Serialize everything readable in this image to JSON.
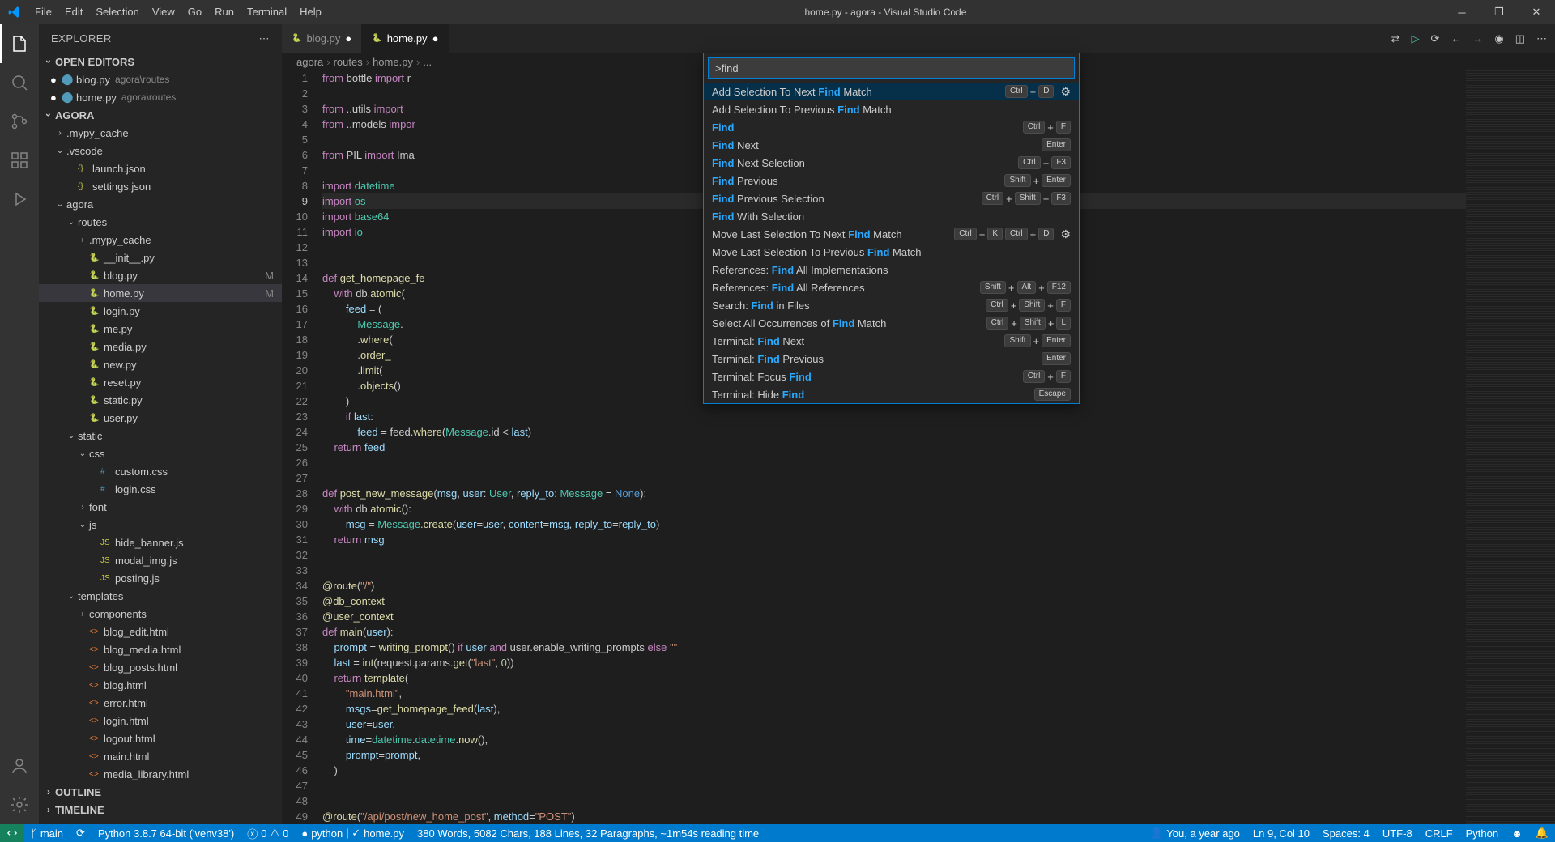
{
  "title": "home.py - agora - Visual Studio Code",
  "menu": [
    "File",
    "Edit",
    "Selection",
    "View",
    "Go",
    "Run",
    "Terminal",
    "Help"
  ],
  "sidebar": {
    "title": "EXPLORER",
    "open_editors": "OPEN EDITORS",
    "project": "AGORA",
    "outline": "OUTLINE",
    "timeline": "TIMELINE",
    "editors": [
      {
        "name": "blog.py",
        "desc": "agora\\routes",
        "mod": true
      },
      {
        "name": "home.py",
        "desc": "agora\\routes",
        "mod": true
      }
    ],
    "tree": [
      {
        "type": "folder",
        "name": ".mypy_cache",
        "indent": 1,
        "exp": false
      },
      {
        "type": "folder",
        "name": ".vscode",
        "indent": 1,
        "exp": true
      },
      {
        "type": "file",
        "name": "launch.json",
        "indent": 2,
        "ico": "json"
      },
      {
        "type": "file",
        "name": "settings.json",
        "indent": 2,
        "ico": "json"
      },
      {
        "type": "folder",
        "name": "agora",
        "indent": 1,
        "exp": true
      },
      {
        "type": "folder",
        "name": "routes",
        "indent": 2,
        "exp": true
      },
      {
        "type": "folder",
        "name": ".mypy_cache",
        "indent": 3,
        "exp": false
      },
      {
        "type": "file",
        "name": "__init__.py",
        "indent": 3,
        "ico": "py"
      },
      {
        "type": "file",
        "name": "blog.py",
        "indent": 3,
        "ico": "py",
        "mod": true
      },
      {
        "type": "file",
        "name": "home.py",
        "indent": 3,
        "ico": "py",
        "mod": true,
        "sel": true
      },
      {
        "type": "file",
        "name": "login.py",
        "indent": 3,
        "ico": "py"
      },
      {
        "type": "file",
        "name": "me.py",
        "indent": 3,
        "ico": "py"
      },
      {
        "type": "file",
        "name": "media.py",
        "indent": 3,
        "ico": "py"
      },
      {
        "type": "file",
        "name": "new.py",
        "indent": 3,
        "ico": "py"
      },
      {
        "type": "file",
        "name": "reset.py",
        "indent": 3,
        "ico": "py"
      },
      {
        "type": "file",
        "name": "static.py",
        "indent": 3,
        "ico": "py"
      },
      {
        "type": "file",
        "name": "user.py",
        "indent": 3,
        "ico": "py"
      },
      {
        "type": "folder",
        "name": "static",
        "indent": 2,
        "exp": true
      },
      {
        "type": "folder",
        "name": "css",
        "indent": 3,
        "exp": true
      },
      {
        "type": "file",
        "name": "custom.css",
        "indent": 4,
        "ico": "css"
      },
      {
        "type": "file",
        "name": "login.css",
        "indent": 4,
        "ico": "css"
      },
      {
        "type": "folder",
        "name": "font",
        "indent": 3,
        "exp": false
      },
      {
        "type": "folder",
        "name": "js",
        "indent": 3,
        "exp": true
      },
      {
        "type": "file",
        "name": "hide_banner.js",
        "indent": 4,
        "ico": "js"
      },
      {
        "type": "file",
        "name": "modal_img.js",
        "indent": 4,
        "ico": "js"
      },
      {
        "type": "file",
        "name": "posting.js",
        "indent": 4,
        "ico": "js"
      },
      {
        "type": "folder",
        "name": "templates",
        "indent": 2,
        "exp": true
      },
      {
        "type": "folder",
        "name": "components",
        "indent": 3,
        "exp": false
      },
      {
        "type": "file",
        "name": "blog_edit.html",
        "indent": 3,
        "ico": "html"
      },
      {
        "type": "file",
        "name": "blog_media.html",
        "indent": 3,
        "ico": "html"
      },
      {
        "type": "file",
        "name": "blog_posts.html",
        "indent": 3,
        "ico": "html"
      },
      {
        "type": "file",
        "name": "blog.html",
        "indent": 3,
        "ico": "html"
      },
      {
        "type": "file",
        "name": "error.html",
        "indent": 3,
        "ico": "html"
      },
      {
        "type": "file",
        "name": "login.html",
        "indent": 3,
        "ico": "html"
      },
      {
        "type": "file",
        "name": "logout.html",
        "indent": 3,
        "ico": "html"
      },
      {
        "type": "file",
        "name": "main.html",
        "indent": 3,
        "ico": "html"
      },
      {
        "type": "file",
        "name": "media_library.html",
        "indent": 3,
        "ico": "html"
      }
    ]
  },
  "tabs": [
    {
      "name": "blog.py",
      "mod": true,
      "active": false
    },
    {
      "name": "home.py",
      "mod": true,
      "active": true
    }
  ],
  "breadcrumb": [
    "agora",
    "routes",
    "home.py",
    "..."
  ],
  "palette": {
    "input": ">find",
    "items": [
      {
        "pre": "Add Selection To Next ",
        "hl": "Find",
        "post": " Match",
        "keys": [
          "Ctrl",
          "+",
          "D"
        ],
        "gear": true,
        "sel": true
      },
      {
        "pre": "Add Selection To Previous ",
        "hl": "Find",
        "post": " Match"
      },
      {
        "pre": "",
        "hl": "Find",
        "post": "",
        "keys": [
          "Ctrl",
          "+",
          "F"
        ]
      },
      {
        "pre": "",
        "hl": "Find",
        "post": " Next",
        "keys": [
          "Enter"
        ]
      },
      {
        "pre": "",
        "hl": "Find",
        "post": " Next Selection",
        "keys": [
          "Ctrl",
          "+",
          "F3"
        ]
      },
      {
        "pre": "",
        "hl": "Find",
        "post": " Previous",
        "keys": [
          "Shift",
          "+",
          "Enter"
        ]
      },
      {
        "pre": "",
        "hl": "Find",
        "post": " Previous Selection",
        "keys": [
          "Ctrl",
          "+",
          "Shift",
          "+",
          "F3"
        ]
      },
      {
        "pre": "",
        "hl": "Find",
        "post": " With Selection"
      },
      {
        "pre": "Move Last Selection To Next ",
        "hl": "Find",
        "post": " Match",
        "keys": [
          "Ctrl",
          "+",
          "K",
          "Ctrl",
          "+",
          "D"
        ],
        "gear": true
      },
      {
        "pre": "Move Last Selection To Previous ",
        "hl": "Find",
        "post": " Match"
      },
      {
        "pre": "References: ",
        "hl": "Find",
        "post": " All Implementations"
      },
      {
        "pre": "References: ",
        "hl": "Find",
        "post": " All References",
        "keys": [
          "Shift",
          "+",
          "Alt",
          "+",
          "F12"
        ]
      },
      {
        "pre": "Search: ",
        "hl": "Find",
        "post": " in Files",
        "keys": [
          "Ctrl",
          "+",
          "Shift",
          "+",
          "F"
        ]
      },
      {
        "pre": "Select All Occurrences of ",
        "hl": "Find",
        "post": " Match",
        "keys": [
          "Ctrl",
          "+",
          "Shift",
          "+",
          "L"
        ]
      },
      {
        "pre": "Terminal: ",
        "hl": "Find",
        "post": " Next",
        "keys": [
          "Shift",
          "+",
          "Enter"
        ]
      },
      {
        "pre": "Terminal: ",
        "hl": "Find",
        "post": " Previous",
        "keys": [
          "Enter"
        ]
      },
      {
        "pre": "Terminal: Focus ",
        "hl": "Find",
        "post": "",
        "keys": [
          "Ctrl",
          "+",
          "F"
        ]
      },
      {
        "pre": "Terminal: Hide ",
        "hl": "Find",
        "post": "",
        "keys": [
          "Escape"
        ]
      }
    ]
  },
  "code_lines": [
    "<span class='tok-kw'>from</span> bottle <span class='tok-kw'>import</span> r",
    "",
    "<span class='tok-kw'>from</span> ..utils <span class='tok-kw'>import</span>",
    "<span class='tok-kw'>from</span> ..models <span class='tok-kw'>impor</span>",
    "",
    "<span class='tok-kw'>from</span> PIL <span class='tok-kw'>import</span> Ima",
    "",
    "<span class='tok-kw'>import</span> <span class='tok-mod'>datetime</span>",
    "<span class='tok-kw'>import</span> <span class='tok-mod'>os</span>",
    "<span class='tok-kw'>import</span> <span class='tok-mod'>base64</span>",
    "<span class='tok-kw'>import</span> <span class='tok-mod'>io</span>",
    "",
    "",
    "<span class='tok-kw'>def</span> <span class='tok-fn'>get_homepage_fe</span>",
    "    <span class='tok-kw'>with</span> db.<span class='tok-fn'>atomic</span>(",
    "        <span class='tok-var'>feed</span> = (",
    "            <span class='tok-cls'>Message</span>.",
    "            .<span class='tok-fn'>where</span>(",
    "            .<span class='tok-fn'>order_</span>",
    "            .<span class='tok-fn'>limit</span>(",
    "            .<span class='tok-fn'>objects</span>()",
    "        )",
    "        <span class='tok-kw'>if</span> <span class='tok-var'>last</span>:",
    "            <span class='tok-var'>feed</span> = feed.<span class='tok-fn'>where</span>(<span class='tok-cls'>Message</span>.id &lt; <span class='tok-var'>last</span>)",
    "    <span class='tok-kw'>return</span> <span class='tok-var'>feed</span>",
    "",
    "",
    "<span class='tok-kw'>def</span> <span class='tok-fn'>post_new_message</span>(<span class='tok-var'>msg</span>, <span class='tok-var'>user</span>: <span class='tok-cls'>User</span>, <span class='tok-var'>reply_to</span>: <span class='tok-cls'>Message</span> = <span class='tok-const'>None</span>):",
    "    <span class='tok-kw'>with</span> db.<span class='tok-fn'>atomic</span>():",
    "        <span class='tok-var'>msg</span> = <span class='tok-cls'>Message</span>.<span class='tok-fn'>create</span>(<span class='tok-var'>user</span>=<span class='tok-var'>user</span>, <span class='tok-var'>content</span>=<span class='tok-var'>msg</span>, <span class='tok-var'>reply_to</span>=<span class='tok-var'>reply_to</span>)",
    "    <span class='tok-kw'>return</span> <span class='tok-var'>msg</span>",
    "",
    "",
    "<span class='tok-fn'>@route</span>(<span class='tok-str'>\"/\"</span>)",
    "<span class='tok-fn'>@db_context</span>",
    "<span class='tok-fn'>@user_context</span>",
    "<span class='tok-kw'>def</span> <span class='tok-fn'>main</span>(<span class='tok-var'>user</span>):",
    "    <span class='tok-var'>prompt</span> = <span class='tok-fn'>writing_prompt</span>() <span class='tok-kw'>if</span> <span class='tok-var'>user</span> <span class='tok-kw'>and</span> user.enable_writing_prompts <span class='tok-kw'>else</span> <span class='tok-str'>\"\"</span>",
    "    <span class='tok-var'>last</span> = <span class='tok-fn'>int</span>(request.params.<span class='tok-fn'>get</span>(<span class='tok-str'>\"last\"</span>, <span class='tok-num'>0</span>))",
    "    <span class='tok-kw'>return</span> <span class='tok-fn'>template</span>(",
    "        <span class='tok-str'>\"main.html\"</span>,",
    "        <span class='tok-var'>msgs</span>=<span class='tok-fn'>get_homepage_feed</span>(<span class='tok-var'>last</span>),",
    "        <span class='tok-var'>user</span>=<span class='tok-var'>user</span>,",
    "        <span class='tok-var'>time</span>=<span class='tok-mod'>datetime</span>.<span class='tok-mod'>datetime</span>.<span class='tok-fn'>now</span>(),",
    "        <span class='tok-var'>prompt</span>=<span class='tok-var'>prompt</span>,",
    "    )",
    "",
    "",
    "<span class='tok-fn'>@route</span>(<span class='tok-str'>\"/api/post/new_home_post\"</span>, <span class='tok-var'>method</span>=<span class='tok-str'>\"POST\"</span>)"
  ],
  "current_line_idx": 9,
  "statusbar": {
    "branch": "main",
    "python": "Python 3.8.7 64-bit ('venv38')",
    "errors": "0",
    "warnings": "0",
    "lang": "python",
    "file": "home.py",
    "stats": "380 Words, 5082 Chars, 188 Lines, 32 Paragraphs, ~1m54s reading time",
    "blame": "You, a year ago",
    "pos": "Ln 9, Col 10",
    "spaces": "Spaces: 4",
    "encoding": "UTF-8",
    "eol": "CRLF",
    "mode": "Python"
  }
}
